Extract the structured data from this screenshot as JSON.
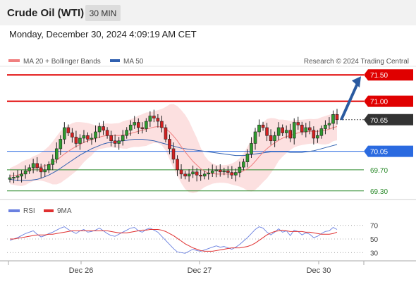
{
  "header": {
    "title": "Crude Oil (WTI)",
    "timeframe": "30 MIN",
    "datetime": "Monday, December 30, 2024 4:09:19 AM CET"
  },
  "legend": {
    "ma20": "MA 20 + Bollinger Bands",
    "ma50": "MA 50",
    "credit": "Research © 2024 Trading Central",
    "ma20_color": "#f08080",
    "ma50_color": "#3060b0"
  },
  "rsi_legend": {
    "rsi": "RSI",
    "ma9": "9MA",
    "rsi_color": "#6a80e0",
    "ma9_color": "#e03030"
  },
  "chart_data": [
    {
      "type": "candlestick",
      "x_ticks": [
        "Dec 26",
        "Dec 27",
        "Dec 30"
      ],
      "levels": [
        {
          "value": 71.5,
          "label": "71.50",
          "style": "resistance",
          "color": "#e00000"
        },
        {
          "value": 71.0,
          "label": "71.00",
          "style": "resistance",
          "color": "#e00000"
        },
        {
          "value": 70.65,
          "label": "70.65",
          "style": "last-price",
          "color": "#333333"
        },
        {
          "value": 70.05,
          "label": "70.05",
          "style": "pivot",
          "color": "#2a6ae0"
        },
        {
          "value": 69.7,
          "label": "69.70",
          "style": "support",
          "color": "#2a8a2a"
        },
        {
          "value": 69.3,
          "label": "69.30",
          "style": "support",
          "color": "#2a8a2a"
        }
      ],
      "forecast_arrow": {
        "from": 70.65,
        "to": 71.5,
        "color": "#2a5aa0"
      },
      "close_series": [
        69.55,
        69.56,
        69.58,
        69.62,
        69.68,
        69.74,
        69.82,
        69.74,
        69.66,
        69.7,
        69.8,
        69.9,
        70.1,
        70.28,
        70.5,
        70.4,
        70.32,
        70.2,
        70.3,
        70.35,
        70.28,
        70.3,
        70.42,
        70.52,
        70.45,
        70.35,
        70.25,
        70.2,
        70.25,
        70.35,
        70.45,
        70.55,
        70.6,
        70.5,
        70.48,
        70.62,
        70.72,
        70.68,
        70.62,
        70.5,
        70.28,
        70.1,
        69.9,
        69.7,
        69.62,
        69.58,
        69.62,
        69.66,
        69.6,
        69.58,
        69.62,
        69.64,
        69.68,
        69.7,
        69.66,
        69.68,
        69.65,
        69.6,
        69.65,
        69.75,
        69.85,
        70.0,
        70.2,
        70.42,
        70.55,
        70.5,
        70.35,
        70.25,
        70.35,
        70.5,
        70.4,
        70.45,
        70.3,
        70.6,
        70.55,
        70.42,
        70.5,
        70.45,
        70.3,
        70.35,
        70.48,
        70.55,
        70.58,
        70.75,
        70.65
      ],
      "ma20_series": [
        69.58,
        69.59,
        69.6,
        69.62,
        69.65,
        69.68,
        69.72,
        69.74,
        69.76,
        69.78,
        69.8,
        69.83,
        69.88,
        69.94,
        70.0,
        70.05,
        70.1,
        70.14,
        70.18,
        70.22,
        70.25,
        70.27,
        70.3,
        70.32,
        70.34,
        70.35,
        70.35,
        70.35,
        70.35,
        70.36,
        70.37,
        70.39,
        70.41,
        70.43,
        70.45,
        70.47,
        70.49,
        70.51,
        70.52,
        70.51,
        70.48,
        70.42,
        70.34,
        70.25,
        70.14,
        70.04,
        69.95,
        69.86,
        69.79,
        69.72,
        69.67,
        69.64,
        69.63,
        69.62,
        69.62,
        69.62,
        69.62,
        69.62,
        69.63,
        69.65,
        69.68,
        69.72,
        69.78,
        69.86,
        69.95,
        70.03,
        70.1,
        70.16,
        70.21,
        70.26,
        70.3,
        70.33,
        70.35,
        70.38,
        70.4,
        70.41,
        70.42,
        70.43,
        70.43,
        70.43,
        70.44,
        70.45,
        70.47,
        70.5,
        70.52
      ],
      "ma50_series": [
        69.52,
        69.51,
        69.5,
        69.5,
        69.5,
        69.5,
        69.51,
        69.52,
        69.54,
        69.57,
        69.6,
        69.64,
        69.68,
        69.73,
        69.78,
        69.83,
        69.88,
        69.93,
        69.98,
        70.02,
        70.06,
        70.1,
        70.13,
        70.16,
        70.19,
        70.21,
        70.22,
        70.23,
        70.24,
        70.25,
        70.26,
        70.27,
        70.28,
        70.28,
        70.28,
        70.27,
        70.26,
        70.25,
        70.23,
        70.21,
        70.19,
        70.17,
        70.15,
        70.13,
        70.11,
        70.1,
        70.09,
        70.08,
        70.07,
        70.06,
        70.05,
        70.04,
        70.03,
        70.02,
        70.01,
        70.0,
        69.99,
        69.98,
        69.97,
        69.97,
        69.97,
        69.98,
        69.99,
        70.0,
        70.01,
        70.02,
        70.03,
        70.04,
        70.04,
        70.04,
        70.04,
        70.04,
        70.03,
        70.03,
        70.03,
        70.03,
        70.04,
        70.05,
        70.06,
        70.08,
        70.1,
        70.12,
        70.14,
        70.16,
        70.18
      ],
      "ylim": [
        69.15,
        71.65
      ]
    },
    {
      "type": "line",
      "title": "RSI",
      "y_ticks": [
        70,
        50,
        30
      ],
      "ylim": [
        20,
        80
      ],
      "rsi_series": [
        48,
        50,
        52,
        55,
        58,
        60,
        62,
        57,
        53,
        55,
        58,
        60,
        63,
        66,
        68,
        64,
        61,
        58,
        62,
        64,
        60,
        61,
        63,
        66,
        62,
        58,
        55,
        54,
        57,
        60,
        63,
        66,
        67,
        62,
        60,
        64,
        66,
        63,
        60,
        54,
        48,
        42,
        36,
        31,
        30,
        29,
        32,
        35,
        33,
        32,
        34,
        36,
        38,
        40,
        38,
        39,
        37,
        35,
        38,
        42,
        47,
        52,
        58,
        64,
        68,
        66,
        60,
        56,
        60,
        65,
        60,
        62,
        55,
        63,
        61,
        56,
        59,
        57,
        52,
        54,
        58,
        61,
        62,
        67,
        64
      ],
      "ma9_series": [
        50,
        50,
        51,
        52,
        53,
        54,
        55,
        56,
        56,
        56,
        57,
        57,
        58,
        59,
        60,
        61,
        62,
        62,
        62,
        62,
        62,
        62,
        62,
        62,
        62,
        62,
        61,
        60,
        59,
        59,
        59,
        60,
        61,
        62,
        63,
        63,
        64,
        64,
        64,
        63,
        61,
        58,
        55,
        51,
        47,
        43,
        40,
        37,
        35,
        33,
        32,
        32,
        32,
        33,
        34,
        35,
        36,
        37,
        37,
        37,
        38,
        39,
        41,
        44,
        48,
        52,
        56,
        59,
        61,
        62,
        63,
        62,
        61,
        61,
        61,
        61,
        60,
        60,
        59,
        58,
        57,
        57,
        57,
        58,
        60
      ]
    }
  ]
}
